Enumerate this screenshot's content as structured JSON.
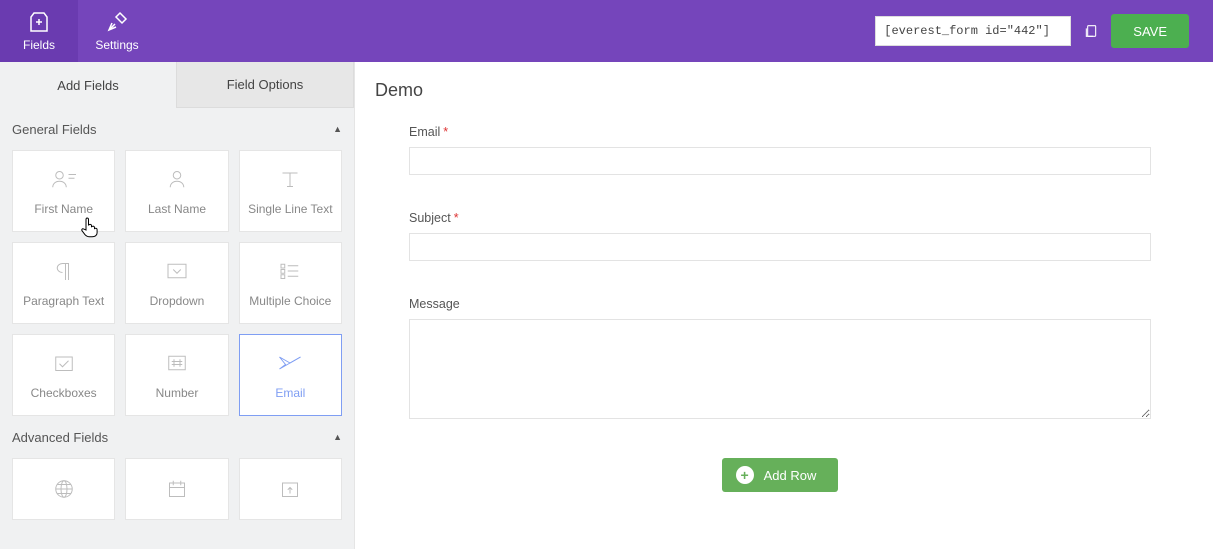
{
  "header": {
    "tabs": [
      {
        "id": "fields",
        "label": "Fields",
        "active": true
      },
      {
        "id": "settings",
        "label": "Settings",
        "active": false
      }
    ],
    "shortcode": "[everest_form id=\"442\"]",
    "save_label": "SAVE"
  },
  "sidebar": {
    "tabs": [
      {
        "id": "add",
        "label": "Add Fields",
        "active": true
      },
      {
        "id": "opts",
        "label": "Field Options",
        "active": false
      }
    ],
    "sections": [
      {
        "title": "General Fields",
        "fields": [
          {
            "id": "first_name",
            "label": "First Name",
            "icon": "first-name-icon"
          },
          {
            "id": "last_name",
            "label": "Last Name",
            "icon": "last-name-icon"
          },
          {
            "id": "single_line",
            "label": "Single Line Text",
            "icon": "text-icon"
          },
          {
            "id": "paragraph",
            "label": "Paragraph Text",
            "icon": "paragraph-icon"
          },
          {
            "id": "dropdown",
            "label": "Dropdown",
            "icon": "dropdown-icon"
          },
          {
            "id": "multiple_choice",
            "label": "Multiple Choice",
            "icon": "multiple-choice-icon"
          },
          {
            "id": "checkboxes",
            "label": "Checkboxes",
            "icon": "checkboxes-icon"
          },
          {
            "id": "number",
            "label": "Number",
            "icon": "number-icon"
          },
          {
            "id": "email",
            "label": "Email",
            "icon": "email-icon",
            "active": true
          }
        ]
      },
      {
        "title": "Advanced Fields",
        "fields": [
          {
            "id": "website",
            "label": "",
            "icon": "globe-icon"
          },
          {
            "id": "date",
            "label": "",
            "icon": "calendar-icon"
          },
          {
            "id": "upload",
            "label": "",
            "icon": "upload-icon"
          }
        ]
      }
    ]
  },
  "form": {
    "title": "Demo",
    "fields": [
      {
        "label": "Email",
        "required": true,
        "type": "text",
        "value": ""
      },
      {
        "label": "Subject",
        "required": true,
        "type": "text",
        "value": ""
      },
      {
        "label": "Message",
        "required": false,
        "type": "textarea",
        "value": ""
      }
    ],
    "add_row_label": "Add Row"
  }
}
